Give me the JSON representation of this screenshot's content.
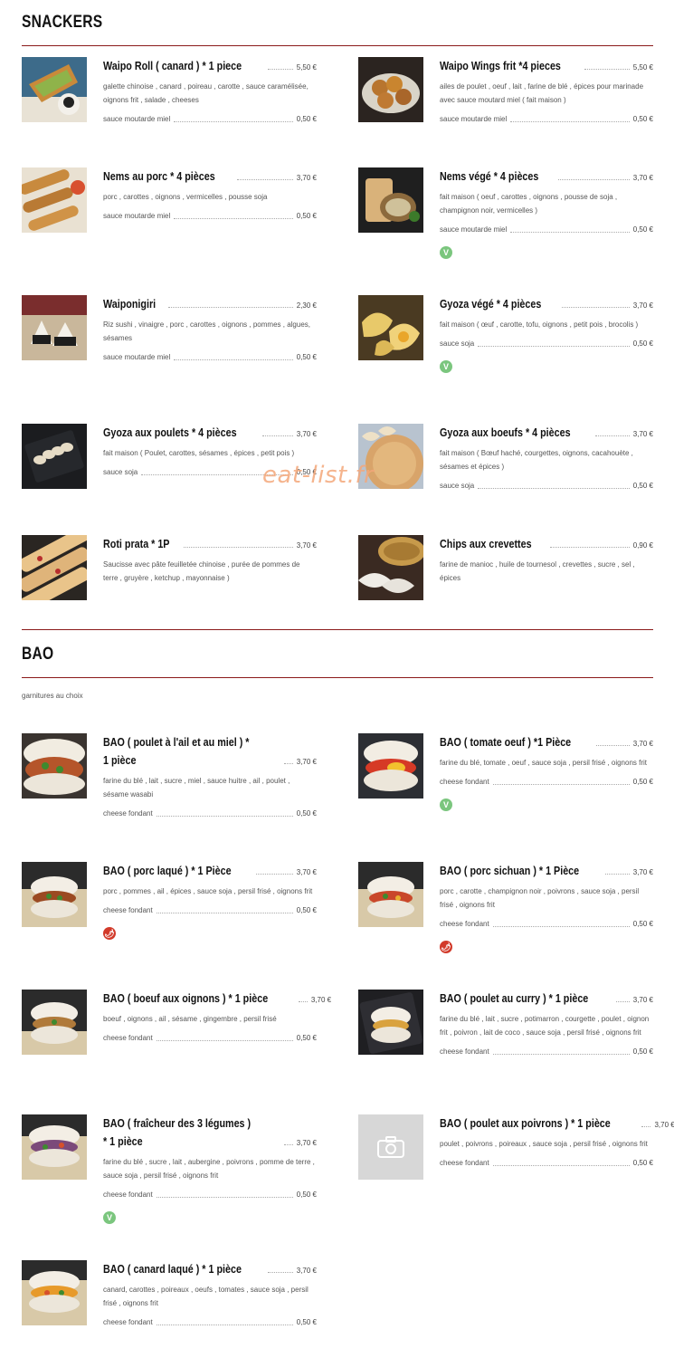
{
  "sections": {
    "snackers": {
      "title": "SNACKERS",
      "items": [
        {
          "name": "Waipo Roll ( canard ) * 1 piece",
          "price": "5,50 €",
          "desc": "galette chinoise , canard , poireau , carotte , sauce caramélisée, oignons frit , salade , cheeses",
          "opt": "sauce moutarde miel",
          "opt_price": "0,50 €"
        },
        {
          "name": "Waipo Wings frit *4 pieces",
          "price": "5,50 €",
          "desc": "ailes de poulet , oeuf , lait , farine de blé , épices pour marinade avec sauce moutard miel ( fait maison )",
          "opt": "sauce moutarde miel",
          "opt_price": "0,50 €"
        },
        {
          "name": "Nems au porc * 4 pièces",
          "price": "3,70 €",
          "desc": "porc , carottes , oignons , vermicelles , pousse soja",
          "opt": "sauce moutarde miel",
          "opt_price": "0,50 €"
        },
        {
          "name": "Nems végé * 4 pièces",
          "price": "3,70 €",
          "desc": "fait maison ( oeuf , carottes , oignons , pousse de soja , champignon noir, vermicelles )",
          "opt": "sauce moutarde miel",
          "opt_price": "0,50 €",
          "badge": "veg"
        },
        {
          "name": "Waiponigiri",
          "price": "2,30 €",
          "desc": "Riz sushi , vinaigre , porc , carottes , oignons , pommes , algues, sésames",
          "opt": "sauce moutarde miel",
          "opt_price": "0,50 €"
        },
        {
          "name": "Gyoza végé * 4 pièces",
          "price": "3,70 €",
          "desc": "fait maison ( œuf , carotte, tofu, oignons , petit pois , brocolis )",
          "opt": "sauce soja",
          "opt_price": "0,50 €",
          "badge": "veg"
        },
        {
          "name": "Gyoza aux poulets * 4 pièces",
          "price": "3,70 €",
          "desc": "fait maison ( Poulet, carottes, sésames , épices , petit pois )",
          "opt": "sauce soja",
          "opt_price": "0,50 €"
        },
        {
          "name": "Gyoza aux boeufs * 4 pièces",
          "price": "3,70 €",
          "desc": "fait maison ( Bœuf haché, courgettes, oignons, cacahouète , sésames et épices )",
          "opt": "sauce soja",
          "opt_price": "0,50 €"
        },
        {
          "name": "Roti prata * 1P",
          "price": "3,70 €",
          "desc": "Saucisse avec pâte feuilletée chinoise , purée de pommes de terre , gruyère , ketchup , mayonnaise )"
        },
        {
          "name": "Chips aux crevettes",
          "price": "0,90 €",
          "desc": "farine de manioc , huile de tournesol , crevettes , sucre , sel , épices"
        }
      ]
    },
    "bao": {
      "title": "BAO",
      "subtitle": "garnitures au choix",
      "items": [
        {
          "name": "BAO ( poulet à l'ail et au miel ) * 1 pièce",
          "price": "3,70 €",
          "desc": "farine du blé , lait , sucre , miel , sauce huitre , ail , poulet , sésame wasabi",
          "opt": "cheese fondant",
          "opt_price": "0,50 €"
        },
        {
          "name": "BAO ( tomate oeuf ) *1 Pièce",
          "price": "3,70 €",
          "desc": "farine du blé, tomate , oeuf , sauce soja , persil frisé , oignons frit",
          "opt": "cheese fondant",
          "opt_price": "0,50 €",
          "badge": "veg"
        },
        {
          "name": "BAO ( porc laqué ) * 1 Pièce",
          "price": "3,70 €",
          "desc": "porc , pommes , ail , épices , sauce soja , persil frisé , oignons frit",
          "opt": "cheese fondant",
          "opt_price": "0,50 €",
          "badge": "spicy"
        },
        {
          "name": "BAO ( porc sichuan ) * 1 Pièce",
          "price": "3,70 €",
          "desc": "porc , carotte , champignon noir , poivrons , sauce soja , persil frisé , oignons frit",
          "opt": "cheese fondant",
          "opt_price": "0,50 €",
          "badge": "spicy"
        },
        {
          "name": "BAO ( boeuf aux oignons ) * 1 pièce",
          "price": "3,70 €",
          "desc": "boeuf , oignons , ail , sésame , gingembre , persil frisé",
          "opt": "cheese fondant",
          "opt_price": "0,50 €"
        },
        {
          "name": "BAO ( poulet au curry ) * 1 pièce",
          "price": "3,70 €",
          "desc": "farine du blé , lait , sucre , potimarron , courgette , poulet , oignon frit , poivron , lait de coco , sauce soja , persil frisé , oignons frit",
          "opt": "cheese fondant",
          "opt_price": "0,50 €"
        },
        {
          "name": "BAO ( fraîcheur des 3 légumes ) * 1 pièce",
          "price": "3,70 €",
          "desc": "farine du blé , sucre , lait , aubergine , poivrons , pomme de terre , sauce soja , persil frisé , oignons frit",
          "opt": "cheese fondant",
          "opt_price": "0,50 €",
          "badge": "veg"
        },
        {
          "name": "BAO ( poulet aux poivrons ) * 1 pièce",
          "price": "3,70 €",
          "desc": "poulet , poivrons , poireaux , sauce soja , persil frisé , oignons frit",
          "opt": "cheese fondant",
          "opt_price": "0,50 €"
        },
        {
          "name": "BAO ( canard laqué ) * 1 pièce",
          "price": "3,70 €",
          "desc": "canard, carottes , poireaux , oeufs , tomates , sauce soja , persil frisé , oignons frit",
          "opt": "cheese fondant",
          "opt_price": "0,50 €"
        }
      ]
    }
  },
  "watermark": "eat-list.fr",
  "badges": {
    "veg": "V",
    "spicy": "🌶"
  },
  "colors": {
    "accent": "#8b1a1a",
    "veg": "#7bc67e",
    "spicy": "#d23a2a"
  }
}
